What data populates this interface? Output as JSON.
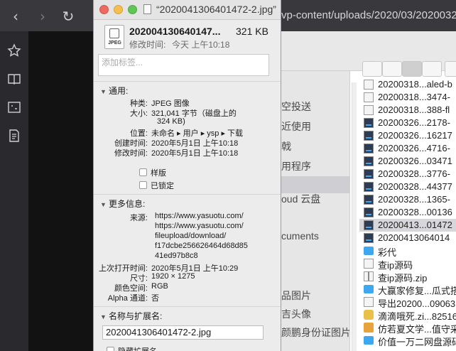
{
  "browser": {
    "url_visible": "vp-content/uploads/2020/03/2020032",
    "nav": {
      "back": "back-icon",
      "forward": "forward-icon",
      "reload": "reload-icon"
    },
    "sidebar_icons": [
      "star-icon",
      "book-icon",
      "screenshot-icon",
      "notes-icon"
    ]
  },
  "finder": {
    "sidebar_labels": [
      "空投送",
      "近使用",
      "戟",
      "用程序",
      "oud 云盘",
      "cuments",
      "品图片",
      "吉头像",
      "颜鹏身份证图片"
    ],
    "files": [
      {
        "name": "20200318...aled-b",
        "icon": "doc",
        "selected": false
      },
      {
        "name": "20200318...3474-",
        "icon": "doc",
        "selected": false
      },
      {
        "name": "20200318...388-fl",
        "icon": "doc",
        "selected": false
      },
      {
        "name": "20200326...2178-",
        "icon": "img",
        "selected": false
      },
      {
        "name": "20200326...16217",
        "icon": "img",
        "selected": false
      },
      {
        "name": "20200326...4716-",
        "icon": "img",
        "selected": false
      },
      {
        "name": "20200326...03471",
        "icon": "img",
        "selected": false
      },
      {
        "name": "20200328...3776-",
        "icon": "img",
        "selected": false
      },
      {
        "name": "20200328...44377",
        "icon": "img",
        "selected": false
      },
      {
        "name": "20200328...1365-",
        "icon": "img",
        "selected": false
      },
      {
        "name": "20200328...00136",
        "icon": "img",
        "selected": false
      },
      {
        "name": "20200413...01472",
        "icon": "img",
        "selected": true
      },
      {
        "name": "20200413064014",
        "icon": "img",
        "selected": false
      },
      {
        "name": "彩代",
        "icon": "folder",
        "selected": false
      },
      {
        "name": "查ip源码",
        "icon": "doc",
        "selected": false
      },
      {
        "name": "查ip源码.zip",
        "icon": "zip",
        "selected": false
      },
      {
        "name": "大赢家修复...瓜式搭",
        "icon": "folder",
        "selected": false
      },
      {
        "name": "导出20200...09063",
        "icon": "doc",
        "selected": false
      },
      {
        "name": "滴滴哦死.zi...82516",
        "icon": "rar",
        "selected": false
      },
      {
        "name": "仿若夏文学...值守采",
        "icon": "color",
        "selected": false
      },
      {
        "name": "价值一万二网盘源码",
        "icon": "folder",
        "selected": false
      }
    ]
  },
  "info": {
    "title": "“2020041306401472-2.jpg”",
    "file_icon_tag": "JPEG",
    "filename": "202004130640147...",
    "size_short": "321 KB",
    "modified_label": "修改时间:",
    "modified_value": "今天 上午10:18",
    "tags_placeholder": "添加标签...",
    "general": {
      "header": "通用:",
      "rows": [
        {
          "label": "种类:",
          "value": "JPEG 图像"
        },
        {
          "label": "大小:",
          "value": "321,041 字节（磁盘上的"
        },
        {
          "label": "",
          "value": "324 KB)"
        },
        {
          "label": "位置:",
          "value": "未命名 ▸ 用户 ▸ ysp ▸ 下载"
        },
        {
          "label": "创建时间:",
          "value": "2020年5月1日 上午10:18"
        },
        {
          "label": "修改时间:",
          "value": "2020年5月1日 上午10:18"
        }
      ],
      "checkboxes": [
        "样版",
        "已锁定"
      ]
    },
    "more": {
      "header": "更多信息:",
      "source_label": "来源:",
      "source_lines": [
        "https://www.yasuotu.com/",
        "https://www.yasuotu.com/",
        "fileupload/download/",
        "f17dcbe256626464d68d85",
        "41ed97b8c8"
      ],
      "rows": [
        {
          "label": "上次打开时间:",
          "value": "2020年5月1日 上午10:29"
        },
        {
          "label": "尺寸:",
          "value": "1920 × 1275"
        },
        {
          "label": "颜色空间:",
          "value": "RGB"
        },
        {
          "label": "Alpha 通道:",
          "value": "否"
        }
      ]
    },
    "name_ext": {
      "header": "名称与扩展名:",
      "value": "2020041306401472-2.jpg",
      "hide_ext_label": "隐藏扩展名"
    }
  }
}
